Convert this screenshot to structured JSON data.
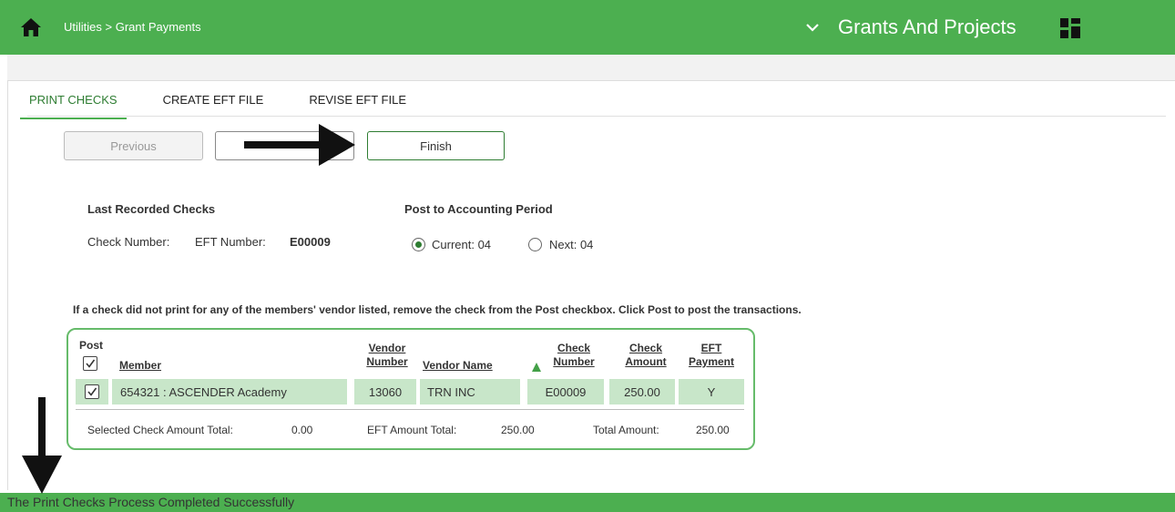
{
  "header": {
    "breadcrumb": "Utilities > Grant Payments",
    "module_title": "Grants And Projects",
    "icons": [
      "home-icon",
      "chevron-down-icon",
      "grid-icon"
    ],
    "colors": {
      "bar": "#4caf50",
      "accent": "#2e7d32"
    }
  },
  "tabs": [
    {
      "label": "PRINT CHECKS",
      "active": true
    },
    {
      "label": "CREATE EFT FILE",
      "active": false
    },
    {
      "label": "REVISE EFT FILE",
      "active": false
    }
  ],
  "buttons": {
    "previous": "Previous",
    "middle": "",
    "finish": "Finish"
  },
  "last_recorded": {
    "title": "Last Recorded Checks",
    "check_number_label": "Check Number:",
    "eft_number_label": "EFT Number:",
    "eft_number_value": "E00009"
  },
  "post_period": {
    "title": "Post to Accounting Period",
    "current_label": "Current: 04",
    "next_label": "Next: 04",
    "selected": "current"
  },
  "instructions": "If a check did not print for any of the members' vendor listed, remove the check from the Post checkbox. Click Post to post the transactions.",
  "table": {
    "headers": {
      "post": "Post",
      "member": "Member",
      "vendor_number_1": "Vendor",
      "vendor_number_2": "Number",
      "vendor_name": "Vendor Name",
      "check_number_1": "Check",
      "check_number_2": "Number",
      "check_amount_1": "Check",
      "check_amount_2": "Amount",
      "eft_payment_1": "EFT",
      "eft_payment_2": "Payment"
    },
    "rows": [
      {
        "post": true,
        "member": "654321 : ASCENDER Academy",
        "vendor_number": "13060",
        "vendor_name": "TRN INC",
        "check_number": "E00009",
        "check_amount": "250.00",
        "eft_payment": "Y"
      }
    ],
    "totals": {
      "selected_label": "Selected Check Amount Total:",
      "selected_value": "0.00",
      "eft_label": "EFT Amount Total:",
      "eft_value": "250.00",
      "total_label": "Total Amount:",
      "total_value": "250.00"
    }
  },
  "status": "The Print Checks Process Completed Successfully"
}
